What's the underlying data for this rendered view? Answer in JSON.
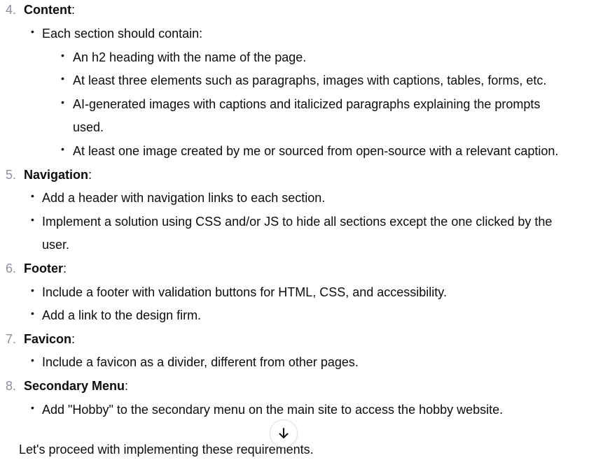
{
  "items": [
    {
      "number": "4.",
      "title": "Content",
      "bullets": [
        {
          "text": "Each section should contain:"
        }
      ],
      "sub_bullets": [
        "An h2 heading with the name of the page.",
        "At least three elements such as paragraphs, images with captions, tables, forms, etc.",
        "AI-generated images with captions and italicized paragraphs explaining the prompts",
        "used.",
        "At least one image created by me or sourced from open-source with a relevant caption."
      ]
    },
    {
      "number": "5.",
      "title": "Navigation",
      "bullets": [
        "Add a header with navigation links to each section.",
        "Implement a solution using CSS and/or JS to hide all sections except the one clicked by the",
        "user."
      ]
    },
    {
      "number": "6.",
      "title": "Footer",
      "bullets": [
        "Include a footer with validation buttons for HTML, CSS, and accessibility.",
        "Add a link to the design firm."
      ]
    },
    {
      "number": "7.",
      "title": "Favicon",
      "bullets": [
        "Include a favicon as a divider, different from other pages."
      ]
    },
    {
      "number": "8.",
      "title": "Secondary Menu",
      "bullets": [
        "Add \"Hobby\" to the secondary menu on the main site to access the hobby website."
      ]
    }
  ],
  "colon": ":",
  "bullet_glyph": "•",
  "footer_text": "Let's proceed with implementing these requirements.",
  "scroll_button_icon": "arrow-down-icon"
}
